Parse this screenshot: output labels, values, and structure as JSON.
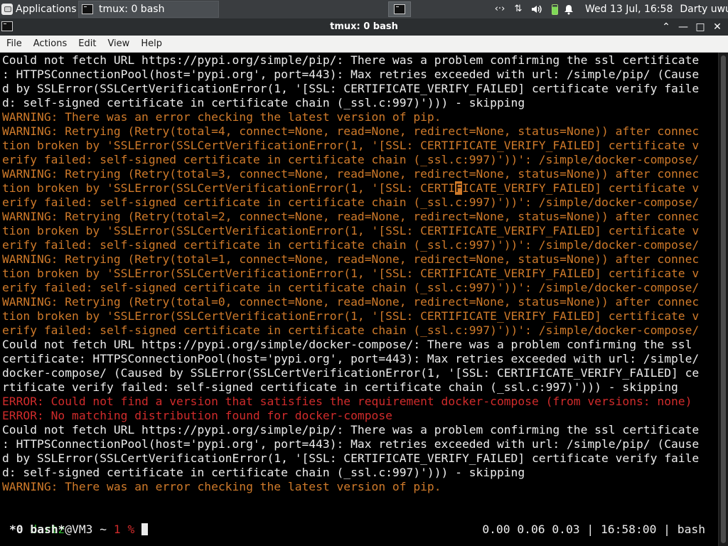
{
  "panel": {
    "apps_label": "Applications",
    "task_label": "tmux: 0 bash",
    "clock": "Wed 13 Jul, 16:58",
    "user": "Darty uwu"
  },
  "window": {
    "title": "tmux: 0 bash"
  },
  "menu": {
    "items": [
      "File",
      "Actions",
      "Edit",
      "View",
      "Help"
    ]
  },
  "terminal": {
    "lines": [
      {
        "t": "Could not fetch URL https://pypi.org/simple/pip/: There was a problem confirming the ssl certificate",
        "c": "white"
      },
      {
        "t": ": HTTPSConnectionPool(host='pypi.org', port=443): Max retries exceeded with url: /simple/pip/ (Cause",
        "c": "white"
      },
      {
        "t": "d by SSLError(SSLCertVerificationError(1, '[SSL: CERTIFICATE_VERIFY_FAILED] certificate verify faile",
        "c": "white"
      },
      {
        "t": "d: self-signed certificate in certificate chain (_ssl.c:997)'))) - skipping",
        "c": "white"
      },
      {
        "t": "WARNING: There was an error checking the latest version of pip.",
        "c": "warn"
      },
      {
        "t": "WARNING: Retrying (Retry(total=4, connect=None, read=None, redirect=None, status=None)) after connec",
        "c": "warn"
      },
      {
        "t": "tion broken by 'SSLError(SSLCertVerificationError(1, '[SSL: CERTIFICATE_VERIFY_FAILED] certificate v",
        "c": "warn"
      },
      {
        "t": "erify failed: self-signed certificate in certificate chain (_ssl.c:997)'))': /simple/docker-compose/",
        "c": "warn"
      },
      {
        "t": "WARNING: Retrying (Retry(total=3, connect=None, read=None, redirect=None, status=None)) after connec",
        "c": "warn"
      },
      {
        "t": "tion broken by 'SSLError(SSLCertVerificationError(1, '[SSL: CERTIFICATE_VERIFY_FAILED] certificate v",
        "c": "warn",
        "hl_after": "CERTI"
      },
      {
        "t": "erify failed: self-signed certificate in certificate chain (_ssl.c:997)'))': /simple/docker-compose/",
        "c": "warn"
      },
      {
        "t": "WARNING: Retrying (Retry(total=2, connect=None, read=None, redirect=None, status=None)) after connec",
        "c": "warn"
      },
      {
        "t": "tion broken by 'SSLError(SSLCertVerificationError(1, '[SSL: CERTIFICATE_VERIFY_FAILED] certificate v",
        "c": "warn"
      },
      {
        "t": "erify failed: self-signed certificate in certificate chain (_ssl.c:997)'))': /simple/docker-compose/",
        "c": "warn"
      },
      {
        "t": "WARNING: Retrying (Retry(total=1, connect=None, read=None, redirect=None, status=None)) after connec",
        "c": "warn"
      },
      {
        "t": "tion broken by 'SSLError(SSLCertVerificationError(1, '[SSL: CERTIFICATE_VERIFY_FAILED] certificate v",
        "c": "warn"
      },
      {
        "t": "erify failed: self-signed certificate in certificate chain (_ssl.c:997)'))': /simple/docker-compose/",
        "c": "warn"
      },
      {
        "t": "WARNING: Retrying (Retry(total=0, connect=None, read=None, redirect=None, status=None)) after connec",
        "c": "warn"
      },
      {
        "t": "tion broken by 'SSLError(SSLCertVerificationError(1, '[SSL: CERTIFICATE_VERIFY_FAILED] certificate v",
        "c": "warn"
      },
      {
        "t": "erify failed: self-signed certificate in certificate chain (_ssl.c:997)'))': /simple/docker-compose/",
        "c": "warn"
      },
      {
        "t": "Could not fetch URL https://pypi.org/simple/docker-compose/: There was a problem confirming the ssl",
        "c": "white"
      },
      {
        "t": "certificate: HTTPSConnectionPool(host='pypi.org', port=443): Max retries exceeded with url: /simple/",
        "c": "white"
      },
      {
        "t": "docker-compose/ (Caused by SSLError(SSLCertVerificationError(1, '[SSL: CERTIFICATE_VERIFY_FAILED] ce",
        "c": "white"
      },
      {
        "t": "rtificate verify failed: self-signed certificate in certificate chain (_ssl.c:997)'))) - skipping",
        "c": "white"
      },
      {
        "t": "ERROR: Could not find a version that satisfies the requirement docker-compose (from versions: none)",
        "c": "err"
      },
      {
        "t": "ERROR: No matching distribution found for docker-compose",
        "c": "err"
      },
      {
        "t": "Could not fetch URL https://pypi.org/simple/pip/: There was a problem confirming the ssl certificate",
        "c": "white"
      },
      {
        "t": ": HTTPSConnectionPool(host='pypi.org', port=443): Max retries exceeded with url: /simple/pip/ (Cause",
        "c": "white"
      },
      {
        "t": "d by SSLError(SSLCertVerificationError(1, '[SSL: CERTIFICATE_VERIFY_FAILED] certificate verify faile",
        "c": "white"
      },
      {
        "t": "d: self-signed certificate in certificate chain (_ssl.c:997)'))) - skipping",
        "c": "white"
      },
      {
        "t": "WARNING: There was an error checking the latest version of pip.",
        "c": "warn"
      },
      {
        "t": "",
        "c": "white"
      }
    ],
    "prompt": {
      "user": "dartz",
      "host": "@VM3",
      "path": " ~ ",
      "code": "1",
      "symbol": " %"
    }
  },
  "tmux": {
    "left": " *0 bash*",
    "right": "0.00 0.06 0.03 | 16:58:00 | bash"
  },
  "colors": {
    "warning": "#cf7a2a",
    "error": "#d02b2b",
    "prompt_user": "#32c232",
    "text": "#ececec",
    "background": "#000000"
  }
}
